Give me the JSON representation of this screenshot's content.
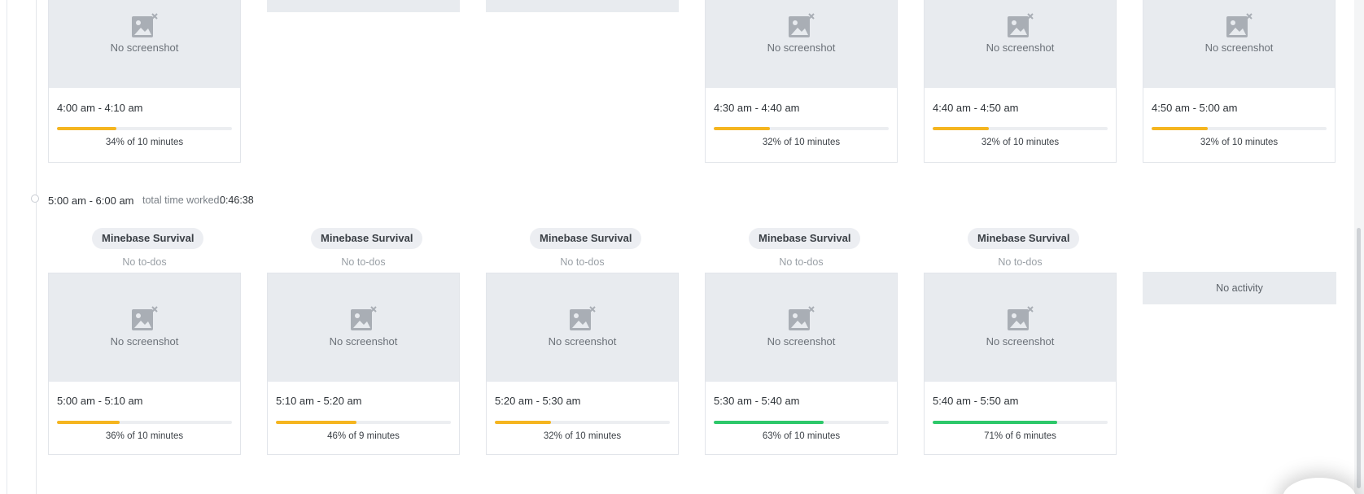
{
  "colors": {
    "orange_bar": "#f5b51f",
    "green_bar": "#2dc86a",
    "placeholder_bg": "#e8ebef"
  },
  "top_row": {
    "cards": [
      {
        "screenshot_label": "No screenshot",
        "time_range": "4:00 am - 4:10 am",
        "percent_label": "34% of 10 minutes",
        "activity_percent": 34,
        "bar_color": "orange"
      },
      {
        "screenshot_label": "No screenshot",
        "time_range": "4:30 am - 4:40 am",
        "percent_label": "32% of 10 minutes",
        "activity_percent": 32,
        "bar_color": "orange"
      },
      {
        "screenshot_label": "No screenshot",
        "time_range": "4:40 am - 4:50 am",
        "percent_label": "32% of 10 minutes",
        "activity_percent": 32,
        "bar_color": "orange"
      },
      {
        "screenshot_label": "No screenshot",
        "time_range": "4:50 am - 5:00 am",
        "percent_label": "32% of 10 minutes",
        "activity_percent": 32,
        "bar_color": "orange"
      }
    ]
  },
  "hour_block": {
    "range": "5:00 am - 6:00 am",
    "total_label": "total time worked:",
    "total_value": "0:46:38",
    "cards": [
      {
        "project": "Minebase Survival",
        "todos": "No to-dos",
        "screenshot_label": "No screenshot",
        "time_range": "5:00 am - 5:10 am",
        "percent_label": "36% of 10 minutes",
        "activity_percent": 36,
        "bar_color": "orange"
      },
      {
        "project": "Minebase Survival",
        "todos": "No to-dos",
        "screenshot_label": "No screenshot",
        "time_range": "5:10 am - 5:20 am",
        "percent_label": "46% of 9 minutes",
        "activity_percent": 46,
        "bar_color": "orange"
      },
      {
        "project": "Minebase Survival",
        "todos": "No to-dos",
        "screenshot_label": "No screenshot",
        "time_range": "5:20 am - 5:30 am",
        "percent_label": "32% of 10 minutes",
        "activity_percent": 32,
        "bar_color": "orange"
      },
      {
        "project": "Minebase Survival",
        "todos": "No to-dos",
        "screenshot_label": "No screenshot",
        "time_range": "5:30 am - 5:40 am",
        "percent_label": "63% of 10 minutes",
        "activity_percent": 63,
        "bar_color": "green"
      },
      {
        "project": "Minebase Survival",
        "todos": "No to-dos",
        "screenshot_label": "No screenshot",
        "time_range": "5:40 am - 5:50 am",
        "percent_label": "71% of 6 minutes",
        "activity_percent": 71,
        "bar_color": "green"
      }
    ],
    "no_activity_label": "No activity"
  },
  "icons": {
    "screenshot_placeholder": "image-off-icon",
    "timeline_node": "timeline-dot-icon"
  }
}
